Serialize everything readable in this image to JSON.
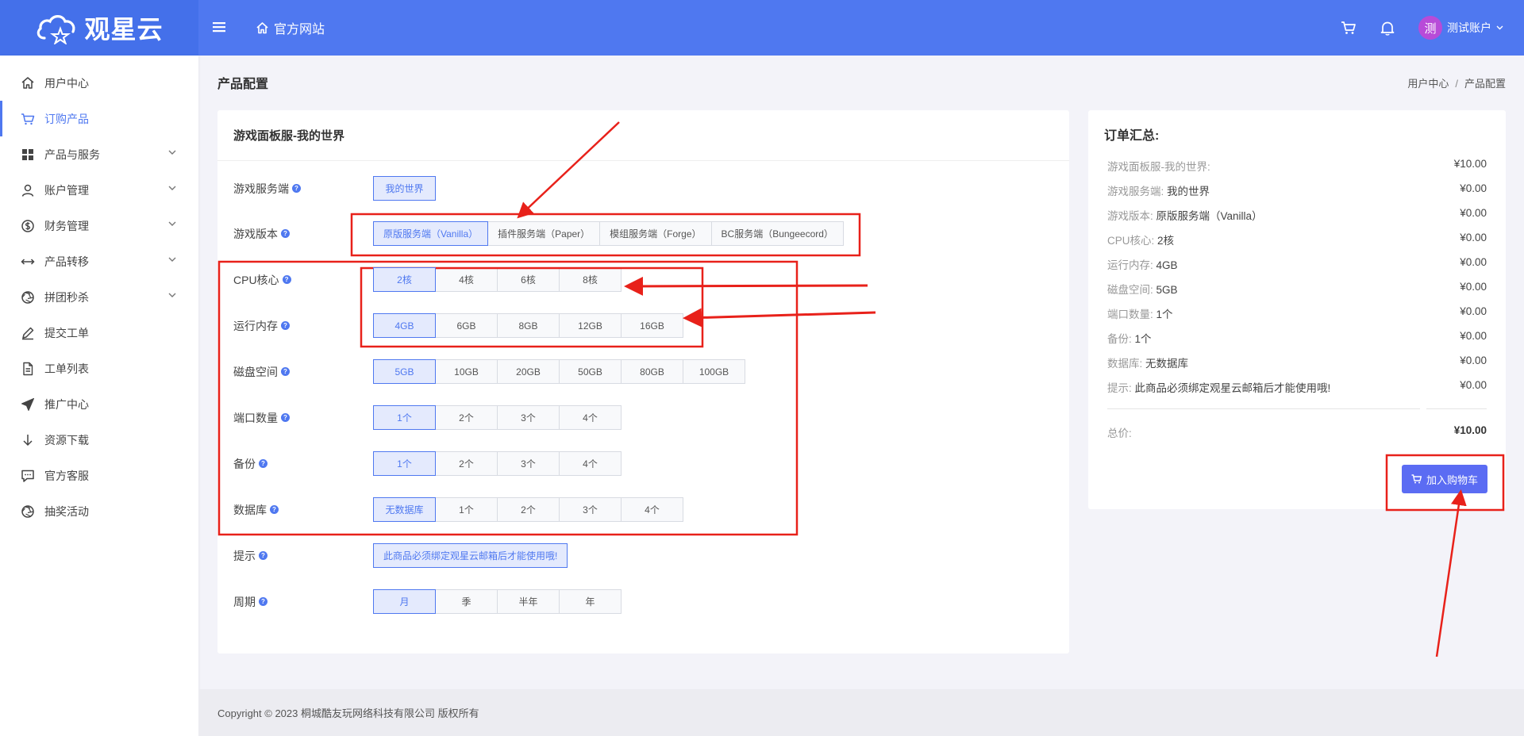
{
  "header": {
    "logo_text": "观星云",
    "home_label": "官方网站",
    "user_avatar_char": "测",
    "user_name": "测试账户"
  },
  "sidebar": {
    "items": [
      {
        "label": "用户中心",
        "icon": "home-icon",
        "expandable": false
      },
      {
        "label": "订购产品",
        "icon": "cart-icon",
        "expandable": false,
        "active": true
      },
      {
        "label": "产品与服务",
        "icon": "grid-icon",
        "expandable": true
      },
      {
        "label": "账户管理",
        "icon": "user-icon",
        "expandable": true
      },
      {
        "label": "财务管理",
        "icon": "dollar-icon",
        "expandable": true
      },
      {
        "label": "产品转移",
        "icon": "transfer-icon",
        "expandable": true
      },
      {
        "label": "拼团秒杀",
        "icon": "aperture-icon",
        "expandable": true
      },
      {
        "label": "提交工单",
        "icon": "edit-icon",
        "expandable": false
      },
      {
        "label": "工单列表",
        "icon": "document-icon",
        "expandable": false
      },
      {
        "label": "推广中心",
        "icon": "send-icon",
        "expandable": false
      },
      {
        "label": "资源下载",
        "icon": "download-icon",
        "expandable": false
      },
      {
        "label": "官方客服",
        "icon": "chat-icon",
        "expandable": false
      },
      {
        "label": "抽奖活动",
        "icon": "aperture-icon",
        "expandable": false
      }
    ]
  },
  "page": {
    "title": "产品配置",
    "breadcrumb": [
      "用户中心",
      "产品配置"
    ]
  },
  "config": {
    "product_title": "游戏面板服-我的世界",
    "rows": [
      {
        "label": "游戏服务端",
        "options": [
          "我的世界"
        ],
        "selected": 0
      },
      {
        "label": "游戏版本",
        "options": [
          "原版服务端（Vanilla）",
          "插件服务端（Paper）",
          "模组服务端（Forge）",
          "BC服务端（Bungeecord）"
        ],
        "selected": 0
      },
      {
        "label": "CPU核心",
        "options": [
          "2核",
          "4核",
          "6核",
          "8核"
        ],
        "selected": 0
      },
      {
        "label": "运行内存",
        "options": [
          "4GB",
          "6GB",
          "8GB",
          "12GB",
          "16GB"
        ],
        "selected": 0
      },
      {
        "label": "磁盘空间",
        "options": [
          "5GB",
          "10GB",
          "20GB",
          "50GB",
          "80GB",
          "100GB"
        ],
        "selected": 0
      },
      {
        "label": "端口数量",
        "options": [
          "1个",
          "2个",
          "3个",
          "4个"
        ],
        "selected": 0
      },
      {
        "label": "备份",
        "options": [
          "1个",
          "2个",
          "3个",
          "4个"
        ],
        "selected": 0
      },
      {
        "label": "数据库",
        "options": [
          "无数据库",
          "1个",
          "2个",
          "3个",
          "4个"
        ],
        "selected": 0
      },
      {
        "label": "提示",
        "options": [
          "此商品必须绑定观星云邮箱后才能使用哦!"
        ],
        "selected": 0
      },
      {
        "label": "周期",
        "options": [
          "月",
          "季",
          "半年",
          "年"
        ],
        "selected": 0
      }
    ]
  },
  "summary": {
    "title": "订单汇总:",
    "items": [
      {
        "key": "游戏面板服-我的世界:",
        "value": "",
        "price": "¥10.00"
      },
      {
        "key": "游戏服务端:",
        "value": "我的世界",
        "price": "¥0.00"
      },
      {
        "key": "游戏版本:",
        "value": "原版服务端（Vanilla）",
        "price": "¥0.00"
      },
      {
        "key": "CPU核心:",
        "value": "2核",
        "price": "¥0.00"
      },
      {
        "key": "运行内存:",
        "value": "4GB",
        "price": "¥0.00"
      },
      {
        "key": "磁盘空间:",
        "value": "5GB",
        "price": "¥0.00"
      },
      {
        "key": "端口数量:",
        "value": "1个",
        "price": "¥0.00"
      },
      {
        "key": "备份:",
        "value": "1个",
        "price": "¥0.00"
      },
      {
        "key": "数据库:",
        "value": "无数据库",
        "price": "¥0.00"
      },
      {
        "key": "提示:",
        "value": "此商品必须绑定观星云邮箱后才能使用哦!",
        "price": "¥0.00"
      }
    ],
    "total_label": "总价:",
    "total_value": "¥10.00",
    "add_to_cart_label": "加入购物车"
  },
  "footer": {
    "copyright": "Copyright © 2023 桐城酷友玩网络科技有限公司 版权所有"
  },
  "colors": {
    "brand": "#4f78f0",
    "selected_bg": "#e4eafd",
    "button": "#5b6cf3",
    "annotation": "#e8211a"
  }
}
